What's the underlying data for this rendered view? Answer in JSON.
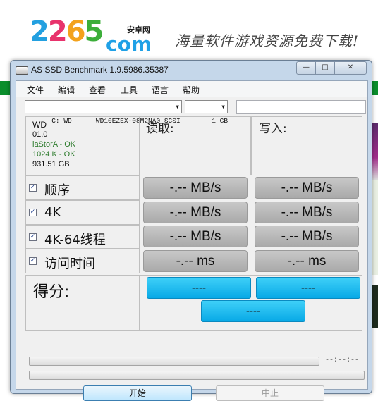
{
  "site": {
    "logo_digits": [
      "2",
      "2",
      "6",
      "5"
    ],
    "logo_com": "com",
    "logo_cn": "安卓网",
    "slogan": "海量软件游戏资源免费下载!"
  },
  "window": {
    "title": "AS SSD Benchmark 1.9.5986.35387",
    "controls": {
      "minimize": "—",
      "maximize": "□",
      "close": "✕"
    }
  },
  "menu": [
    "文件",
    "编辑",
    "查看",
    "工具",
    "语言",
    "帮助"
  ],
  "toolbar": {
    "drive_select": "C: WD      WD10EZEX-08M2NA0 SCSI",
    "size_select": "1 GB",
    "extra_field": ""
  },
  "info": {
    "vendor": "WD",
    "firmware": "01.0",
    "driver": "iaStorA - OK",
    "alignment": "1024 K - OK",
    "capacity": "931.51 GB",
    "ok_color": "#2a7a2a"
  },
  "columns": {
    "read": "读取:",
    "write": "写入:"
  },
  "tests": [
    {
      "label": "顺序",
      "checked": true,
      "read": "-.-- MB/s",
      "write": "-.-- MB/s"
    },
    {
      "label": "4K",
      "checked": true,
      "read": "-.-- MB/s",
      "write": "-.-- MB/s"
    },
    {
      "label": "4K-64线程",
      "checked": true,
      "read": "-.-- MB/s",
      "write": "-.-- MB/s"
    },
    {
      "label": "访问时间",
      "checked": true,
      "read": "-.-- ms",
      "write": "-.-- ms"
    }
  ],
  "score": {
    "label": "得分:",
    "read": "----",
    "write": "----",
    "total": "----"
  },
  "progress": {
    "elapsed": "--:--:--",
    "bar1": 0,
    "bar2": 0
  },
  "buttons": {
    "start": "开始",
    "stop": "中止"
  }
}
